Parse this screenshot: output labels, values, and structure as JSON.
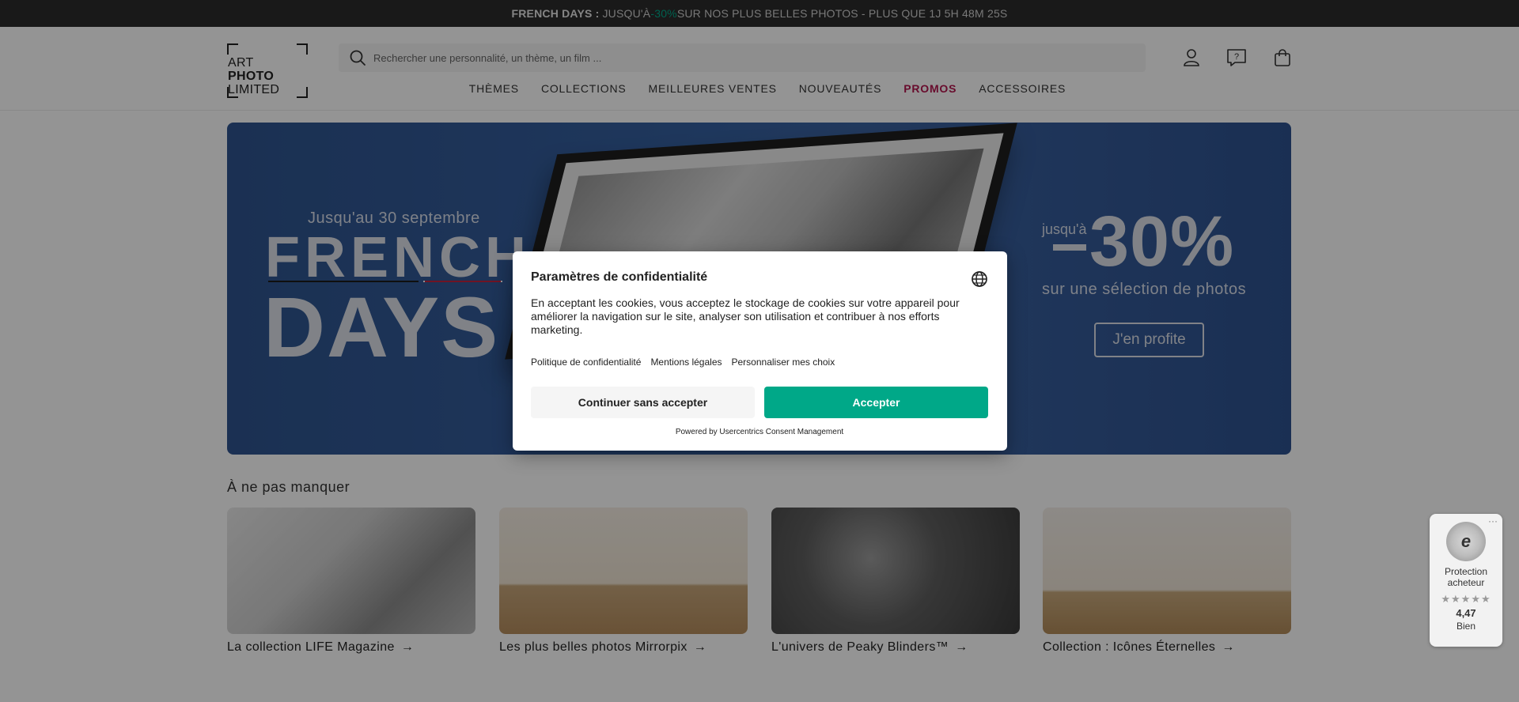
{
  "promo_bar": {
    "bold": "FRENCH DAYS :",
    "pre": " JUSQU'À ",
    "pct": "-30%",
    "post": " SUR NOS PLUS BELLES PHOTOS - PLUS QUE 1J 5H 48M 25S"
  },
  "logo": {
    "line1": "ART",
    "line2": "PHOTO",
    "line3": "LIMITED"
  },
  "search": {
    "placeholder": "Rechercher une personnalité, un thème, un film ..."
  },
  "header_icons": [
    "user-icon",
    "help-icon",
    "bag-icon"
  ],
  "nav": [
    {
      "label": "Thèmes"
    },
    {
      "label": "Collections"
    },
    {
      "label": "Meilleures ventes"
    },
    {
      "label": "Nouveautés"
    },
    {
      "label": "Promos",
      "accent": "#b4154e"
    },
    {
      "label": "Accessoires"
    }
  ],
  "hero": {
    "until": "Jusqu'au 30 septembre",
    "french": "FRENCH",
    "days": "DAYS",
    "upto": "jusqu'à",
    "pct": "30%",
    "selection": "sur une sélection de photos",
    "cta": "J'en profite"
  },
  "section": {
    "title": "À ne pas manquer",
    "cards": [
      {
        "caption": "La collection LIFE Magazine",
        "arrow": "→"
      },
      {
        "caption": "Les plus belles photos Mirrorpix",
        "arrow": "→"
      },
      {
        "caption": "L'univers de Peaky Blinders™",
        "arrow": "→"
      },
      {
        "caption": "Collection : Icônes Éternelles",
        "arrow": "→"
      }
    ]
  },
  "consent": {
    "title": "Paramètres de confidentialité",
    "body": "En acceptant les cookies, vous acceptez le stockage de cookies sur votre appareil pour améliorer la navigation sur le site, analyser son utilisation et contribuer à nos efforts marketing.",
    "links": [
      "Politique de confidentialité",
      "Mentions légales",
      "Personnaliser mes choix"
    ],
    "deny": "Continuer sans accepter",
    "accept": "Accepter",
    "powered": "Powered by Usercentrics Consent Management",
    "accent": "#00a888"
  },
  "trust_badge": {
    "more": "···",
    "seal": "e",
    "label": "Protection acheteur",
    "stars": "★★★★★",
    "score": "4,47",
    "verdict": "Bien"
  }
}
